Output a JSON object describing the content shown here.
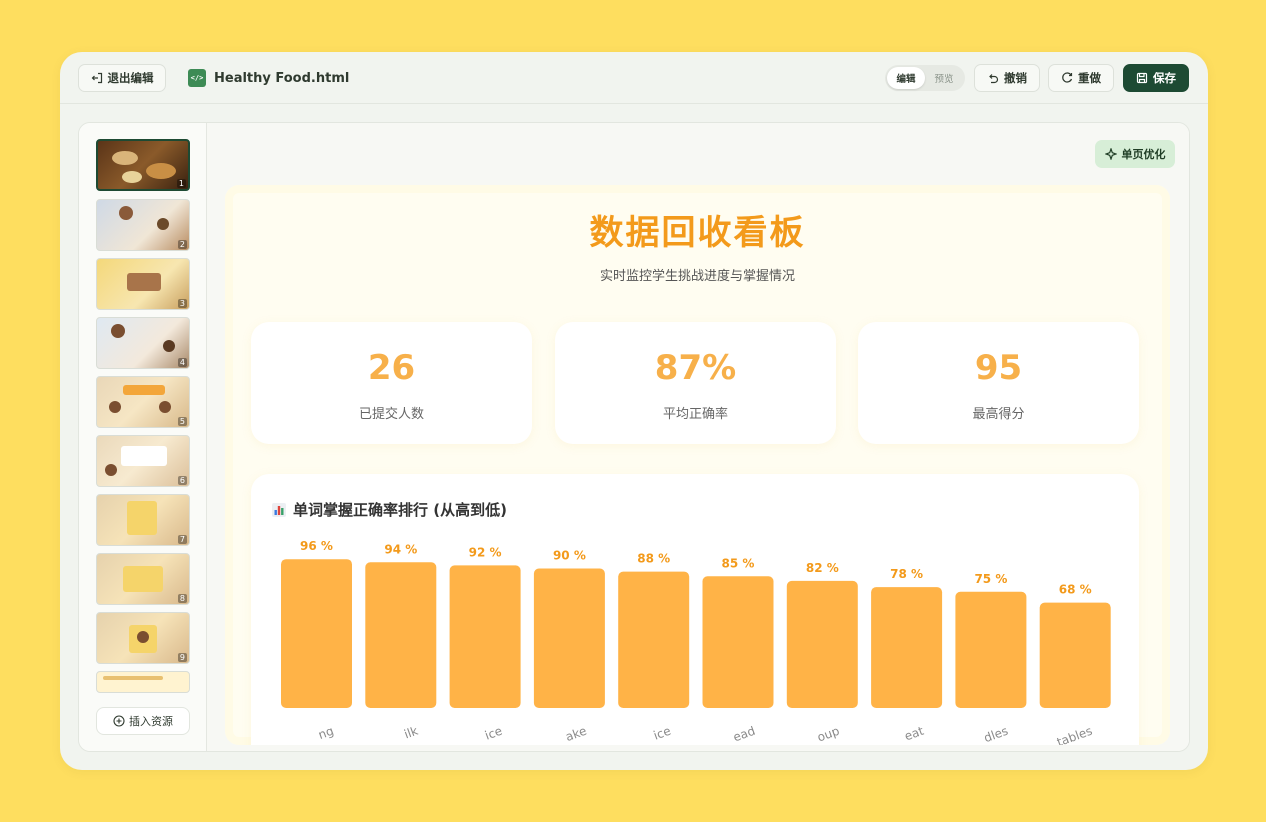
{
  "toolbar": {
    "exit_label": "退出编辑",
    "file_name": "Healthy Food.html",
    "file_icon_glyph": "</>",
    "mode_edit": "编辑",
    "mode_preview": "预览",
    "undo_label": "撤销",
    "redo_label": "重做",
    "save_label": "保存"
  },
  "sidebar": {
    "slides": [
      "1",
      "2",
      "3",
      "4",
      "5",
      "6",
      "7",
      "8",
      "9"
    ],
    "insert_label": "插入资源"
  },
  "canvas": {
    "optimize_label": "单页优化"
  },
  "slide": {
    "title": "数据回收看板",
    "subtitle": "实时监控学生挑战进度与掌握情况",
    "stats": [
      {
        "value": "26",
        "label": "已提交人数"
      },
      {
        "value": "87%",
        "label": "平均正确率"
      },
      {
        "value": "95",
        "label": "最高得分"
      }
    ],
    "chart_heading": "单词掌握正确率排行 (从高到低)"
  },
  "colors": {
    "background": "#FEDE5F",
    "accent": "#F39A1B",
    "bar": "#FFB347",
    "save_button": "#1D4A33",
    "optimize_button": "#D7EED7"
  },
  "chart_data": {
    "type": "bar",
    "categories": [
      "...ng",
      "...ilk",
      "...ice",
      "...ake",
      "...ice",
      "...ead",
      "...oup",
      "...eat",
      "...dles",
      "...tables"
    ],
    "values": [
      96,
      94,
      92,
      90,
      88,
      85,
      82,
      78,
      75,
      68
    ],
    "value_suffix": " %",
    "title": "单词掌握正确率排行 (从高到低)",
    "xlabel": "",
    "ylabel": "",
    "ylim": [
      0,
      100
    ],
    "grid": false,
    "legend": "none"
  }
}
